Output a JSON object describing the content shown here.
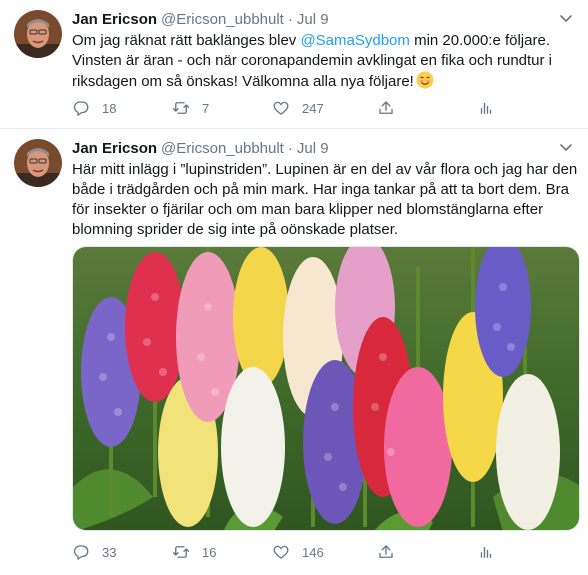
{
  "tweets": [
    {
      "author_name": "Jan Ericson",
      "handle": "@Ericson_ubbhult",
      "separator": "·",
      "date": "Jul 9",
      "text_before_mention": "Om jag räknat rätt baklänges blev ",
      "mention": "@SamaSydbom",
      "text_after_mention": " min 20.000:e följare. Vinsten är äran - och när coronapandemin avklingat en fika och rundtur i riksdagen om så önskas! Välkomna alla nya följare!",
      "emoji_icon": "smiling-face-emoji",
      "reply_count": "18",
      "retweet_count": "7",
      "like_count": "247"
    },
    {
      "author_name": "Jan Ericson",
      "handle": "@Ericson_ubbhult",
      "separator": "·",
      "date": "Jul 9",
      "text": "Här mitt inlägg i ”lupinstriden”. Lupinen är en del av vår flora och jag har den både i trädgården och på min mark. Har inga tankar på att ta bort dem. Bra för insekter o fjärilar och om man bara klipper ned blomstänglarna efter blomning sprider de sig inte på oönskade platser.",
      "media_subject": "lupine-flowers-photo",
      "reply_count": "33",
      "retweet_count": "16",
      "like_count": "146"
    }
  ],
  "icons": [
    "chevron-down-icon",
    "reply-icon",
    "retweet-icon",
    "like-icon",
    "share-icon",
    "analytics-icon"
  ],
  "colors": {
    "text": "#14171a",
    "secondary": "#657786",
    "link": "#1da1f2",
    "border": "#e6ecf0"
  }
}
